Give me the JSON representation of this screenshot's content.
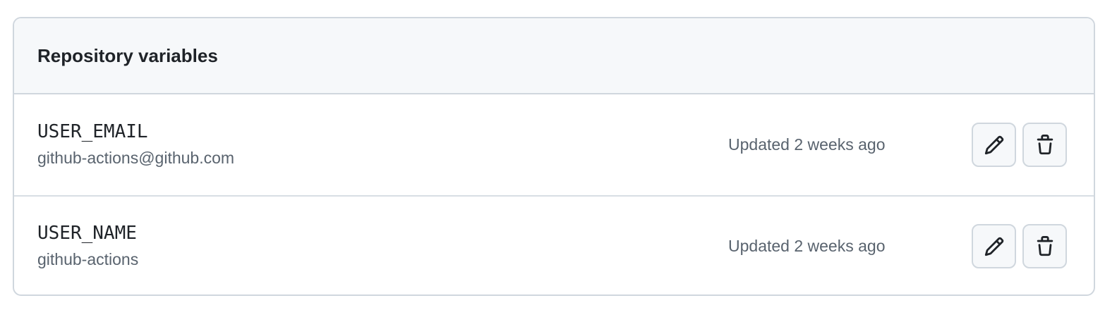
{
  "panel": {
    "title": "Repository variables"
  },
  "variables": [
    {
      "name": "USER_EMAIL",
      "value": "github-actions@github.com",
      "updated": "Updated 2 weeks ago",
      "edit_icon": "pencil-icon",
      "delete_icon": "trash-icon"
    },
    {
      "name": "USER_NAME",
      "value": "github-actions",
      "updated": "Updated 2 weeks ago",
      "edit_icon": "pencil-icon",
      "delete_icon": "trash-icon"
    }
  ],
  "colors": {
    "border": "#d0d7de",
    "header_bg": "#f6f8fa",
    "text": "#1f2328",
    "muted": "#59636e"
  }
}
